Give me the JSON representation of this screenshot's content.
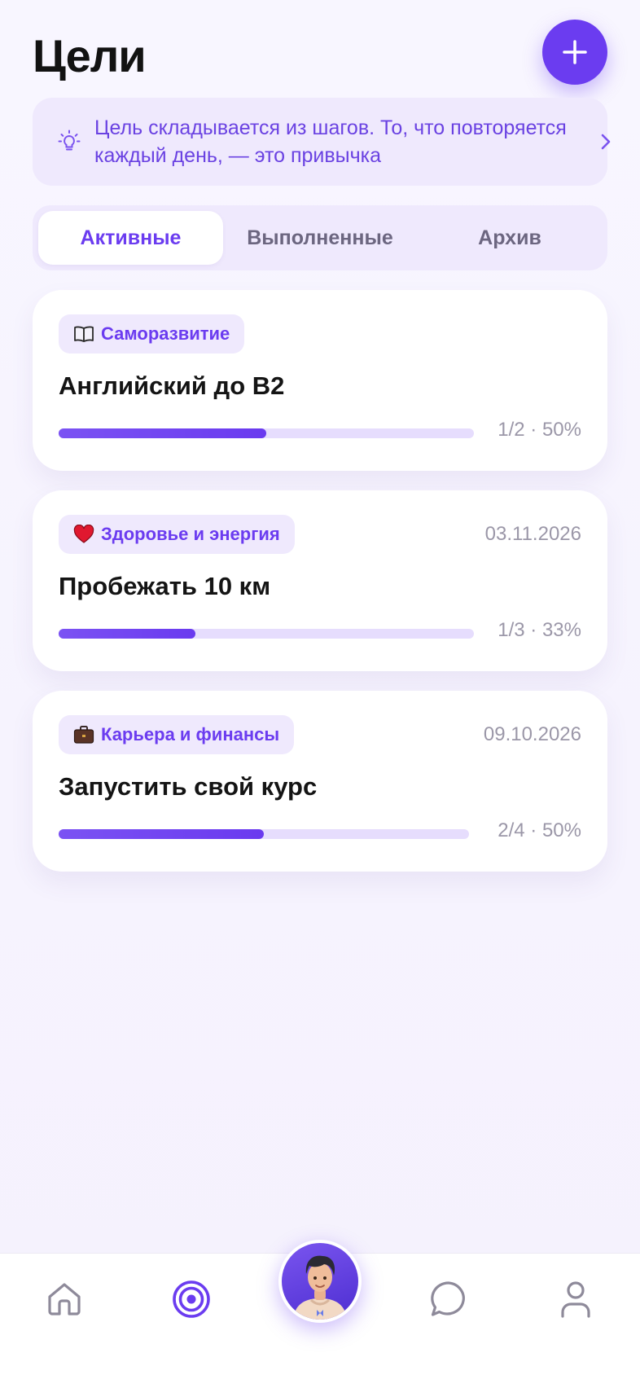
{
  "header": {
    "title": "Цели",
    "add_button": "add"
  },
  "hint": {
    "text": "Цель складывается из шагов. То, что повторяется каждый день, — это привычка"
  },
  "tabs": [
    {
      "label": "Активные",
      "active": true
    },
    {
      "label": "Выполненные",
      "active": false
    },
    {
      "label": "Архив",
      "active": false
    }
  ],
  "goals": [
    {
      "category": "Саморазвитие",
      "category_icon": "book-icon",
      "title": "Английский до B2",
      "date": "",
      "progress_text": "1/2 · 50%",
      "progress": 0.5
    },
    {
      "category": "Здоровье и энергия",
      "category_icon": "heart-icon",
      "title": "Пробежать 10 км",
      "date": "03.11.2026",
      "progress_text": "1/3 · 33%",
      "progress": 0.33
    },
    {
      "category": "Карьера и финансы",
      "category_icon": "briefcase-icon",
      "title": "Запустить свой курс",
      "date": "09.10.2026",
      "progress_text": "2/4 · 50%",
      "progress": 0.5
    }
  ],
  "nav": [
    {
      "name": "home-icon"
    },
    {
      "name": "target-icon",
      "active": true
    },
    {
      "name": "avatar"
    },
    {
      "name": "chat-icon"
    },
    {
      "name": "profile-icon"
    }
  ],
  "colors": {
    "accent": "#6b3cf0",
    "tint": "#efe9fd",
    "muted": "#9b97a8"
  }
}
